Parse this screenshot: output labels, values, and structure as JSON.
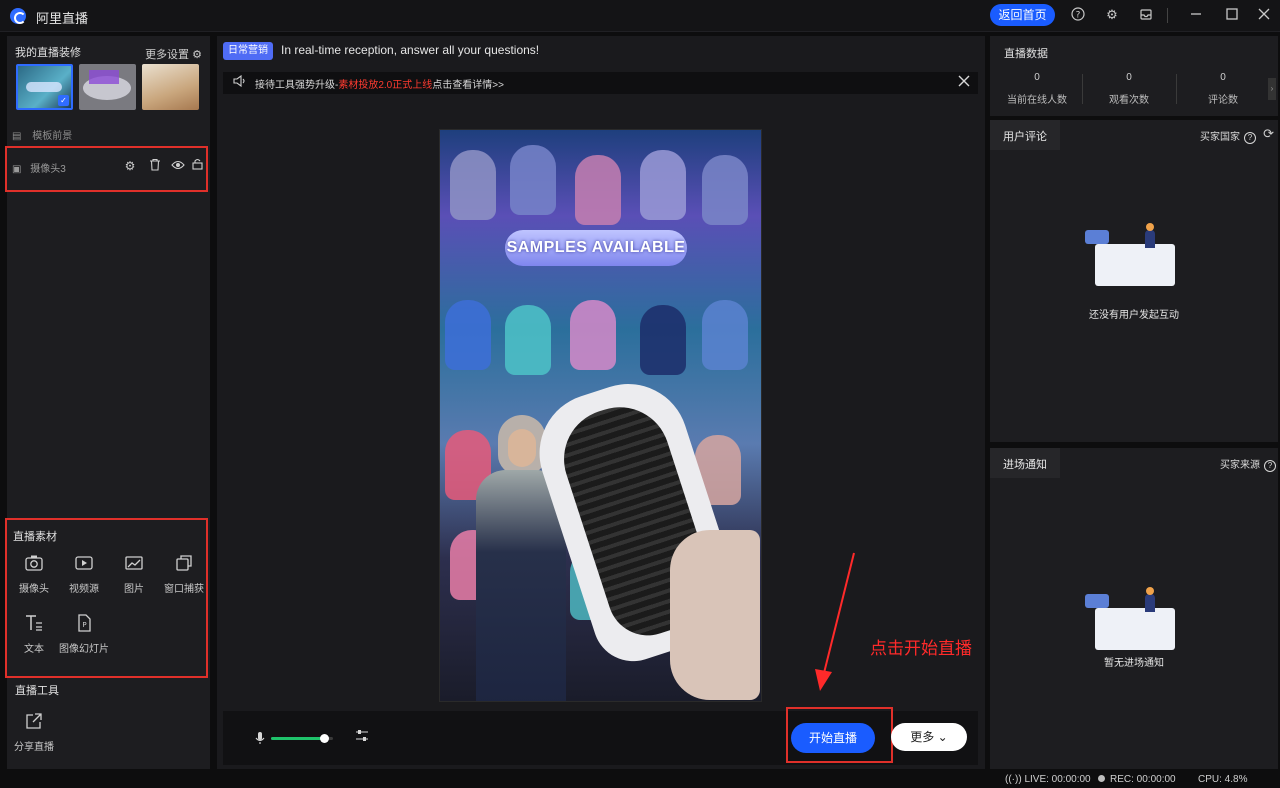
{
  "window": {
    "title": "阿里直播",
    "home_button": "返回首页"
  },
  "left": {
    "decor_title": "我的直播装修",
    "more_settings": "更多设置",
    "template_bg_label": "模板前景",
    "camera_layer_label": "摄像头3",
    "materials_title": "直播素材",
    "materials": [
      {
        "label": "摄像头",
        "icon": "camera-icon"
      },
      {
        "label": "视频源",
        "icon": "video-source-icon"
      },
      {
        "label": "图片",
        "icon": "image-icon"
      },
      {
        "label": "窗口捕获",
        "icon": "window-capture-icon"
      },
      {
        "label": "文本",
        "icon": "text-icon"
      },
      {
        "label": "图像幻灯片",
        "icon": "slideshow-icon"
      }
    ],
    "tools_title": "直播工具",
    "tools": [
      {
        "label": "分享直播",
        "icon": "share-icon"
      }
    ]
  },
  "center": {
    "promo_tag": "日常营销",
    "promo_text": "In real-time reception, answer all your questions!",
    "notice_prefix": "接待工具强势升级-",
    "notice_highlight": "素材投放2.0正式上线",
    "notice_suffix": "点击查看详情>>",
    "video_badge": "SAMPLES AVAILABLE",
    "mic_volume_percent": 85,
    "start_button": "开始直播",
    "more_button": "更多"
  },
  "annotation": {
    "text": "点击开始直播",
    "color": "#ff2a2a"
  },
  "right": {
    "stats_title": "直播数据",
    "stats": [
      {
        "value": "0",
        "label": "当前在线人数"
      },
      {
        "value": "0",
        "label": "观看次数"
      },
      {
        "value": "0",
        "label": "评论数"
      }
    ],
    "comments_tab": "用户评论",
    "comments_right": "买家国家",
    "comments_empty": "还没有用户发起互动",
    "entries_tab": "进场通知",
    "entries_right": "买家来源",
    "entries_empty": "暂无进场通知"
  },
  "status": {
    "live": "LIVE: 00:00:00",
    "rec": "REC: 00:00:00",
    "cpu": "CPU: 4.8%"
  },
  "colors": {
    "accent": "#1a5cff",
    "highlight_red": "#e0302a"
  }
}
